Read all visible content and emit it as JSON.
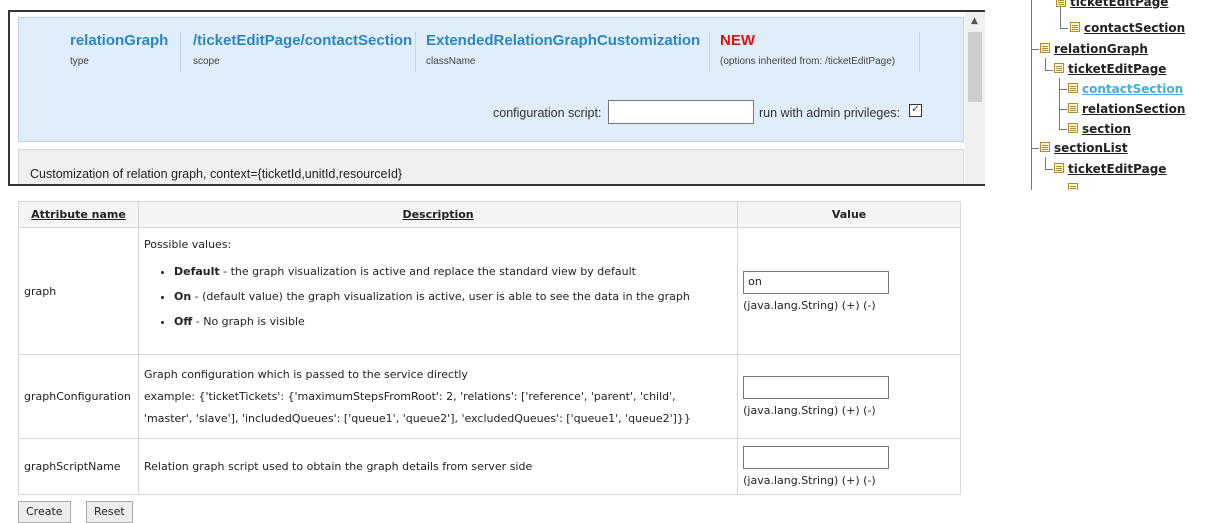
{
  "header": {
    "type": {
      "value": "relationGraph",
      "label": "type"
    },
    "scope": {
      "value": "/ticketEditPage/contactSection",
      "label": "scope"
    },
    "className": {
      "value": "ExtendedRelationGraphCustomization",
      "label": "className"
    },
    "status": {
      "value": "NEW",
      "note": "(options inherited from: /ticketEditPage)"
    }
  },
  "config": {
    "script_label": "configuration script:",
    "script_value": "",
    "admin_label": "run with admin privileges:",
    "admin_checked": true
  },
  "description": "Customization of relation graph, context={ticketId,unitId,resourceId}",
  "tree": {
    "items": [
      {
        "label": "ticketEditPage",
        "selected": false
      },
      {
        "label": "contactSection",
        "selected": false
      },
      {
        "label": "relationGraph",
        "selected": false
      },
      {
        "label": "ticketEditPage",
        "selected": false
      },
      {
        "label": "contactSection",
        "selected": true
      },
      {
        "label": "relationSection",
        "selected": false
      },
      {
        "label": "section",
        "selected": false
      },
      {
        "label": "sectionList",
        "selected": false
      },
      {
        "label": "ticketEditPage",
        "selected": false
      }
    ]
  },
  "table": {
    "headers": [
      "Attribute name",
      "Description",
      "Value"
    ],
    "rows": [
      {
        "name": "graph",
        "intro": "Possible values:",
        "options": [
          {
            "bold": "Default",
            "text": " - the graph visualization is active and replace the standard view by default"
          },
          {
            "bold": "On",
            "text": " - (default value) the graph visualization is active, user is able to see the data in the graph"
          },
          {
            "bold": "Off",
            "text": " - No graph is visible"
          }
        ],
        "value": "on",
        "meta": "(java.lang.String) (+) (-)"
      },
      {
        "name": "graphConfiguration",
        "desc1": "Graph configuration which is passed to the service directly",
        "desc2": "example: {'ticketTickets': {'maximumStepsFromRoot': 2, 'relations': ['reference', 'parent', 'child',",
        "desc3": "'master', 'slave'], 'includedQueues': ['queue1', 'queue2'], 'excludedQueues': ['queue1', 'queue2']}}",
        "value": "",
        "meta": "(java.lang.String) (+) (-)"
      },
      {
        "name": "graphScriptName",
        "desc1": "Relation graph script used to obtain the graph details from server side",
        "value": "",
        "meta": "(java.lang.String) (+) (-)"
      }
    ]
  },
  "buttons": {
    "create": "Create",
    "reset": "Reset"
  },
  "colors": {
    "accent": "#2b86c4",
    "new": "#e01010",
    "selected_tree": "#3ab0e0",
    "info_bg": "#dfeefa"
  }
}
